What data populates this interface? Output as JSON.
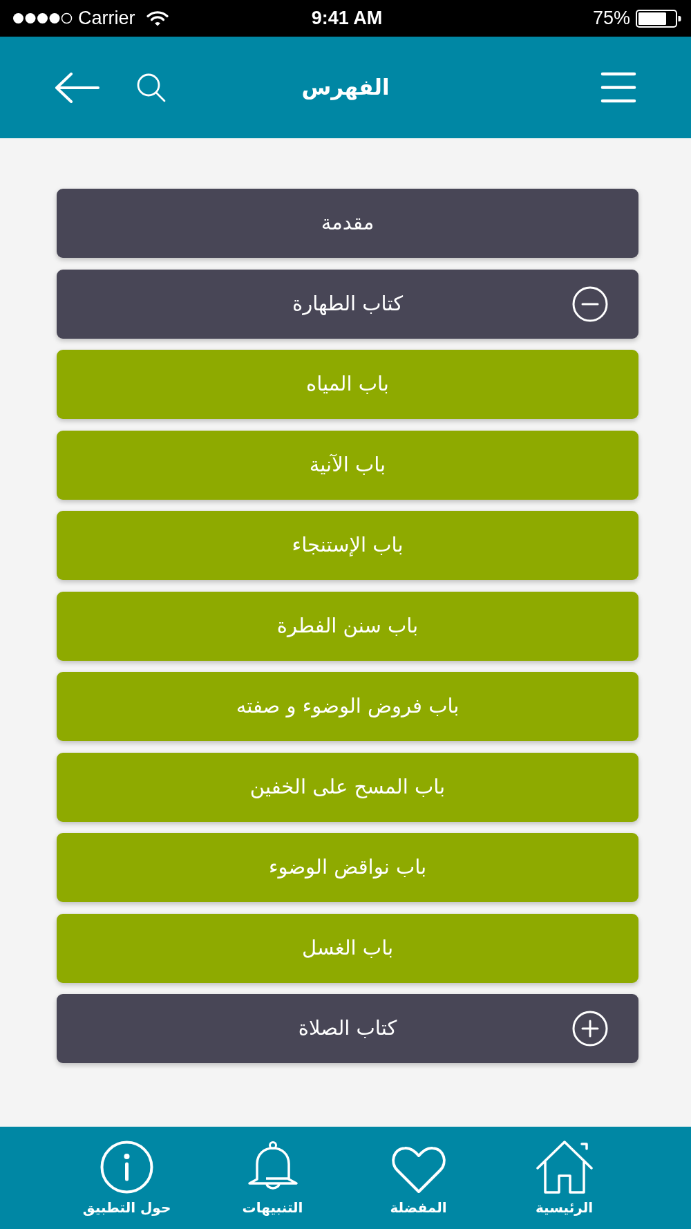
{
  "status_bar": {
    "carrier": "Carrier",
    "time": "9:41 AM",
    "battery": "75%"
  },
  "header": {
    "title": "الفهرس"
  },
  "index": [
    {
      "kind": "page",
      "label": "مقدمة"
    },
    {
      "kind": "chapter",
      "label": "كتاب الطهارة",
      "expanded": true,
      "children": [
        {
          "label": "باب المياه"
        },
        {
          "label": "باب الآنية"
        },
        {
          "label": "باب الإستنجاء"
        },
        {
          "label": "باب سنن الفطرة"
        },
        {
          "label": "باب فروض الوضوء و صفته"
        },
        {
          "label": "باب المسح على الخفين"
        },
        {
          "label": "باب نواقض الوضوء"
        },
        {
          "label": "باب الغسل"
        }
      ]
    },
    {
      "kind": "chapter",
      "label": "كتاب الصلاة",
      "expanded": false
    }
  ],
  "tab_bar": [
    {
      "kind": "home",
      "label": "الرئيسية"
    },
    {
      "kind": "favorites",
      "label": "المفضلة"
    },
    {
      "kind": "notifications",
      "label": "التنبيهات"
    },
    {
      "kind": "about",
      "label": "حول التطبيق"
    }
  ]
}
